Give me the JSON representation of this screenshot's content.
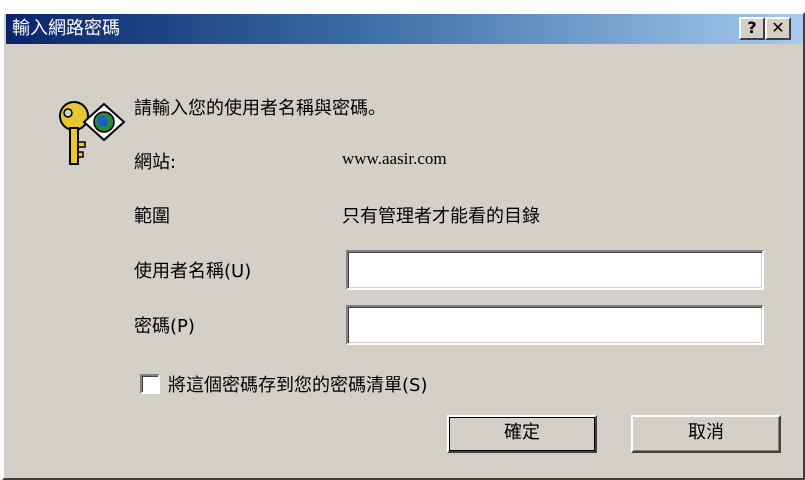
{
  "window": {
    "title": "輸入網路密碼",
    "help_label": "?",
    "close_label": "✕"
  },
  "prompt": "請輸入您的使用者名稱與密碼。",
  "site": {
    "label": "網站:",
    "value": "www.aasir.com"
  },
  "realm": {
    "label": "範圍",
    "value": "只有管理者才能看的目錄"
  },
  "username": {
    "label": "使用者名稱(U)",
    "value": ""
  },
  "password": {
    "label": "密碼(P)",
    "value": ""
  },
  "save_password": {
    "label": "將這個密碼存到您的密碼清單(S)",
    "checked": false
  },
  "buttons": {
    "ok": "確定",
    "cancel": "取消"
  },
  "icons": {
    "prompt_icon": "key-globe-icon"
  }
}
